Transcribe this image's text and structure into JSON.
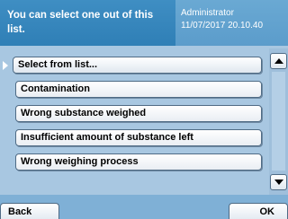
{
  "header": {
    "message": "You can select one out of this\nlist.",
    "user": "Administrator",
    "datetime": "11/07/2017 20.10.40"
  },
  "list": {
    "items": [
      {
        "label": "Select from list...",
        "selected": true
      },
      {
        "label": "Contamination",
        "selected": false
      },
      {
        "label": "Wrong substance weighed",
        "selected": false
      },
      {
        "label": "Insufficient amount of substance left",
        "selected": false
      },
      {
        "label": "Wrong weighing process",
        "selected": false
      }
    ]
  },
  "footer": {
    "back_label": "Back",
    "ok_label": "OK"
  }
}
